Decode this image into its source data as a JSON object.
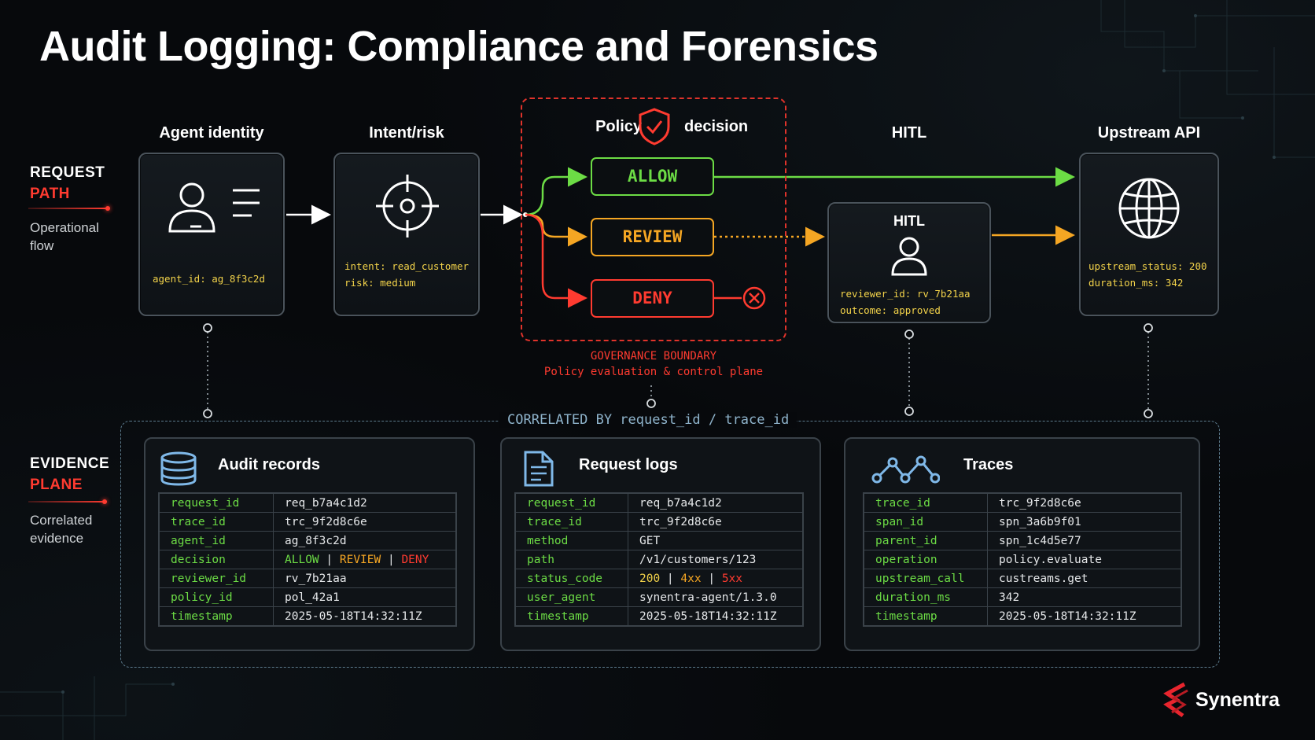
{
  "title": "Audit Logging: Compliance and Forensics",
  "request_path": {
    "heading_line1": "REQUEST",
    "heading_line2": "PATH",
    "subtitle_line1": "Operational",
    "subtitle_line2": "flow"
  },
  "evidence_plane": {
    "heading_line1": "EVIDENCE",
    "heading_line2": "PLANE",
    "subtitle_line1": "Correlated",
    "subtitle_line2": "evidence"
  },
  "nodes": {
    "agent_identity": {
      "label": "Agent identity",
      "detail": "agent_id: ag_8f3c2d",
      "icon": "user-id-icon"
    },
    "intent_risk": {
      "label": "Intent/risk",
      "detail_line1": "intent: read_customer",
      "detail_line2": "risk: medium",
      "icon": "target-icon"
    },
    "policy_decision": {
      "label_left": "Policy",
      "label_right": "decision",
      "icon": "shield-check-icon"
    },
    "hitl": {
      "label": "HITL",
      "inner_label": "HITL",
      "detail_line1": "reviewer_id: rv_7b21aa",
      "detail_line2": "outcome: approved",
      "icon": "user-icon"
    },
    "upstream_api": {
      "label": "Upstream API",
      "detail_line1": "upstream_status: 200",
      "detail_line2": "duration_ms: 342",
      "icon": "globe-icon"
    }
  },
  "decisions": {
    "allow": "ALLOW",
    "review": "REVIEW",
    "deny": "DENY"
  },
  "governance": {
    "caption_line1": "GOVERNANCE BOUNDARY",
    "caption_line2": "Policy evaluation & control plane"
  },
  "correlation_label": "CORRELATED BY request_id / trace_id",
  "panels": {
    "audit_records": {
      "title": "Audit records",
      "icon": "database-icon",
      "rows": [
        {
          "key": "request_id",
          "value": "req_b7a4c1d2"
        },
        {
          "key": "trace_id",
          "value": "trc_9f2d8c6e"
        },
        {
          "key": "agent_id",
          "value": "ag_8f3c2d"
        },
        {
          "key": "decision",
          "value": "ALLOW | REVIEW | DENY"
        },
        {
          "key": "reviewer_id",
          "value": "rv_7b21aa"
        },
        {
          "key": "policy_id",
          "value": "pol_42a1"
        },
        {
          "key": "timestamp",
          "value": "2025-05-18T14:32:11Z"
        }
      ]
    },
    "request_logs": {
      "title": "Request logs",
      "icon": "document-icon",
      "rows": [
        {
          "key": "request_id",
          "value": "req_b7a4c1d2"
        },
        {
          "key": "trace_id",
          "value": "trc_9f2d8c6e"
        },
        {
          "key": "method",
          "value": "GET"
        },
        {
          "key": "path",
          "value": "/v1/customers/123"
        },
        {
          "key": "status_code",
          "value": "200 | 4xx | 5xx"
        },
        {
          "key": "user_agent",
          "value": "synentra-agent/1.3.0"
        },
        {
          "key": "timestamp",
          "value": "2025-05-18T14:32:11Z"
        }
      ]
    },
    "traces": {
      "title": "Traces",
      "icon": "trace-graph-icon",
      "rows": [
        {
          "key": "trace_id",
          "value": "trc_9f2d8c6e"
        },
        {
          "key": "span_id",
          "value": "spn_3a6b9f01"
        },
        {
          "key": "parent_id",
          "value": "spn_1c4d5e77"
        },
        {
          "key": "operation",
          "value": "policy.evaluate"
        },
        {
          "key": "upstream_call",
          "value": "custreams.get"
        },
        {
          "key": "duration_ms",
          "value": "342"
        },
        {
          "key": "timestamp",
          "value": "2025-05-18T14:32:11Z"
        }
      ]
    }
  },
  "brand": {
    "name": "Synentra",
    "icon": "synentra-logo-icon"
  },
  "colors": {
    "allow": "#6cdc45",
    "review": "#f5a623",
    "deny": "#ff3b30",
    "key_text": "#6cdc45",
    "detail_text": "#f3d34a"
  }
}
